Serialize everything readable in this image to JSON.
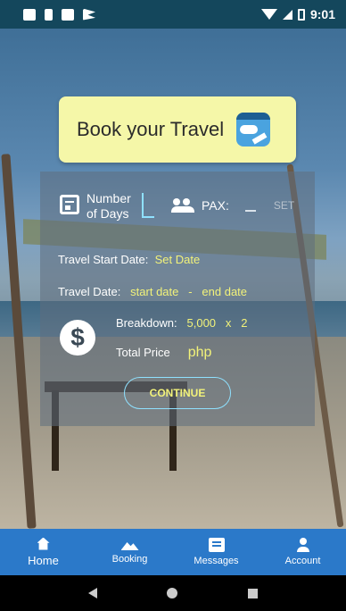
{
  "status_bar": {
    "time": "9:01"
  },
  "header": {
    "title": "Book your Travel",
    "icon": "travel-icon"
  },
  "form": {
    "days_label_line1": "Number",
    "days_label_line2": "of Days",
    "days_value": "",
    "pax_label": "PAX:",
    "pax_value": "",
    "set_label": "SET",
    "start_label": "Travel Start Date:",
    "start_value": "Set Date",
    "travel_label": "Travel Date:",
    "travel_start": "start date",
    "travel_sep": "-",
    "travel_end": "end date",
    "breakdown_label": "Breakdown:",
    "breakdown_price": "5,000",
    "breakdown_x": "x",
    "breakdown_qty": "2",
    "total_label": "Total Price",
    "total_currency": "php",
    "continue_label": "CONTINUE"
  },
  "bottom_nav": {
    "items": [
      {
        "label": "Home",
        "icon": "home-icon",
        "active": true
      },
      {
        "label": "Booking",
        "icon": "mountain-icon"
      },
      {
        "label": "Messages",
        "icon": "message-icon"
      },
      {
        "label": "Account",
        "icon": "account-icon"
      }
    ]
  },
  "colors": {
    "accent": "#f2f27a",
    "nav": "#2b79c9",
    "header_card": "#f5f7a8",
    "status_bar": "#14475c"
  }
}
